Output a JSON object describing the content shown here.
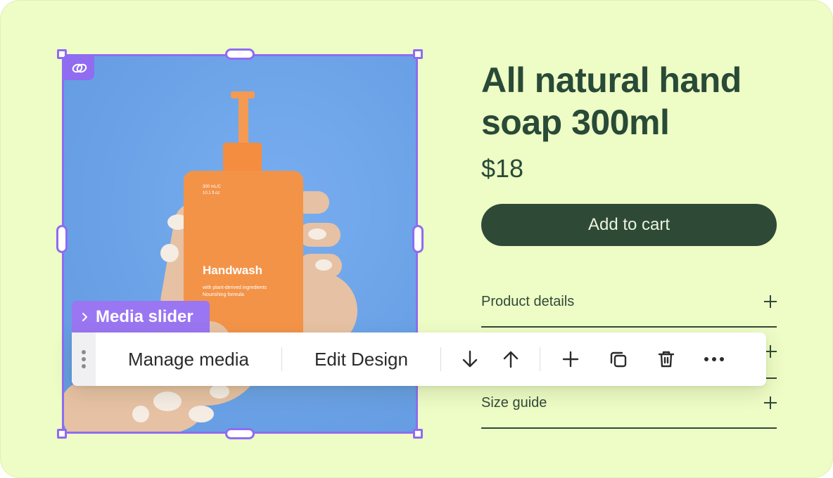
{
  "product": {
    "title": "All natural hand soap 300ml",
    "price": "$18",
    "add_to_cart_label": "Add to cart",
    "accordion": [
      {
        "label": "Product details",
        "icon": "plus-icon"
      },
      {
        "label": "",
        "icon": "plus-icon"
      },
      {
        "label": "Size guide",
        "icon": "plus-icon"
      }
    ]
  },
  "media": {
    "element_tag_label": "Media slider",
    "bottle_volume": "300 mL/C\n10.1 fl.oz",
    "bottle_name": "Handwash",
    "bottle_tagline": "with plant-derived ingredients\nNourishing formula",
    "link_icon": "link-icon"
  },
  "toolbar": {
    "manage_media_label": "Manage media",
    "edit_design_label": "Edit Design",
    "icons": [
      "drag-handle-icon",
      "arrow-down-icon",
      "arrow-up-icon",
      "plus-icon",
      "duplicate-icon",
      "trash-icon",
      "more-icon"
    ]
  },
  "colors": {
    "background": "#eefcc5",
    "selection": "#8f6cf0",
    "heading": "#284a37",
    "button": "#2e4a37",
    "bottle": "#f39348",
    "sky": "#6fa6ea"
  }
}
